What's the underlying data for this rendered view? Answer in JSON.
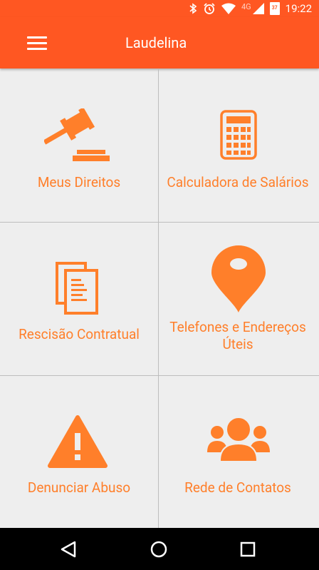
{
  "status_bar": {
    "time": "19:22",
    "network": "4G",
    "battery": "37"
  },
  "app_bar": {
    "title": "Laudelina",
    "menu_icon": "hamburger-menu-icon"
  },
  "tiles": [
    {
      "label": "Meus Direitos",
      "icon": "gavel-icon"
    },
    {
      "label": "Calculadora de Salários",
      "icon": "calculator-icon"
    },
    {
      "label": "Rescisão Contratual",
      "icon": "documents-icon"
    },
    {
      "label": "Telefones e Endereços",
      "label2": "Úteis",
      "icon": "map-pin-icon"
    },
    {
      "label": "Denunciar Abuso",
      "icon": "warning-icon"
    },
    {
      "label": "Rede de Contatos",
      "icon": "group-icon"
    }
  ],
  "colors": {
    "primary": "#ff5722",
    "accent": "#ff7f2a",
    "background": "#eeeeee"
  }
}
